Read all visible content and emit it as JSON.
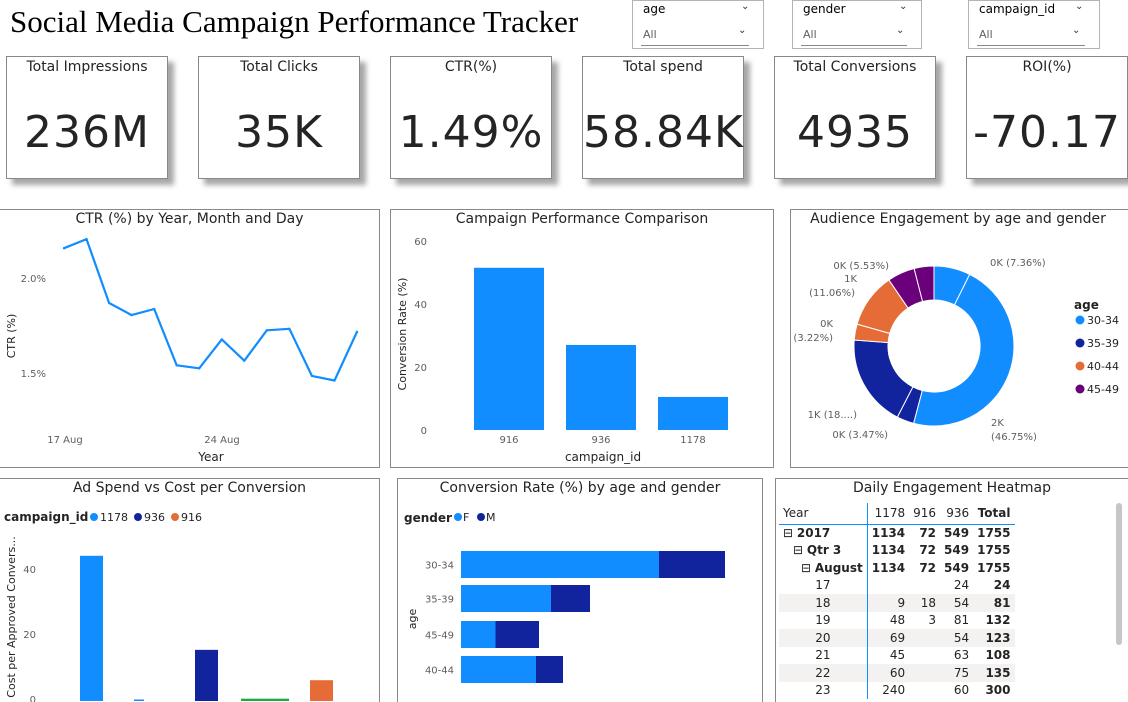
{
  "title": "Social Media Campaign Performance Tracker",
  "slicers": [
    {
      "label": "age",
      "value": "All"
    },
    {
      "label": "gender",
      "value": "All"
    },
    {
      "label": "campaign_id",
      "value": "All"
    }
  ],
  "kpis": [
    {
      "label": "Total Impressions",
      "value": "236M"
    },
    {
      "label": "Total Clicks",
      "value": "35K"
    },
    {
      "label": "CTR(%)",
      "value": "1.49%"
    },
    {
      "label": "Total spend",
      "value": "58.84K"
    },
    {
      "label": "Total Conversions",
      "value": "4935"
    },
    {
      "label": "ROI(%)",
      "value": "-70.17"
    }
  ],
  "colors": {
    "blue": "#118dff",
    "navy": "#12239e",
    "orange": "#e66c37",
    "purple": "#6b007b",
    "teal": "#1aab40"
  },
  "ctr_chart": {
    "title": "CTR (%) by Year, Month and Day",
    "xlabel": "Year",
    "ylabel": "CTR (%)",
    "y_ticks": [
      "2.0%",
      "1.5%"
    ],
    "x_ticks": [
      "17 Aug",
      "24 Aug"
    ]
  },
  "campaign_chart": {
    "title": "Campaign Performance Comparison",
    "xlabel": "campaign_id",
    "ylabel": "Conversion Rate (%)",
    "y_ticks": [
      "60",
      "40",
      "20",
      "0"
    ]
  },
  "donut_chart": {
    "title": "Audience Engagement by age and gender",
    "legend_title": "age",
    "labels": {
      "l3034a": "2K",
      "l3034b": "(46.75%)",
      "l3539": "0K (3.47%)",
      "l3539b": "1K (18....)",
      "l4044a": "0K",
      "l4044b": "(3.22%)",
      "l4049a": "1K",
      "l4049b": "(11.06%)",
      "l4549": "0K (5.53%)",
      "ltop": "0K (7.36%)"
    }
  },
  "adspend_chart": {
    "title": "Ad Spend vs Cost per Conversion",
    "legend_title": "campaign_id",
    "ylabel": "Cost per Approved Convers...",
    "y_ticks": [
      "40",
      "20",
      "0"
    ]
  },
  "conv_chart": {
    "title": "Conversion Rate (%) by age and gender",
    "legend_title": "gender",
    "ylabel": "age"
  },
  "heatmap": {
    "title": "Daily Engagement Heatmap",
    "headers": [
      "Year",
      "1178",
      "916",
      "936",
      "Total"
    ],
    "rows": [
      {
        "label": "2017",
        "cells": [
          "1134",
          "72",
          "549",
          "1755"
        ],
        "kind": "year"
      },
      {
        "label": "Qtr 3",
        "cells": [
          "1134",
          "72",
          "549",
          "1755"
        ],
        "kind": "qtr"
      },
      {
        "label": "August",
        "cells": [
          "1134",
          "72",
          "549",
          "1755"
        ],
        "kind": "month"
      },
      {
        "label": "17",
        "cells": [
          "",
          "",
          "24",
          "24"
        ],
        "kind": "day"
      },
      {
        "label": "18",
        "cells": [
          "9",
          "18",
          "54",
          "81"
        ],
        "kind": "day"
      },
      {
        "label": "19",
        "cells": [
          "48",
          "3",
          "81",
          "132"
        ],
        "kind": "day"
      },
      {
        "label": "20",
        "cells": [
          "69",
          "",
          "54",
          "123"
        ],
        "kind": "day"
      },
      {
        "label": "21",
        "cells": [
          "45",
          "",
          "63",
          "108"
        ],
        "kind": "day"
      },
      {
        "label": "22",
        "cells": [
          "60",
          "",
          "75",
          "135"
        ],
        "kind": "day"
      },
      {
        "label": "23",
        "cells": [
          "240",
          "",
          "60",
          "300"
        ],
        "kind": "day"
      }
    ]
  },
  "chart_data": [
    {
      "type": "line",
      "title": "CTR (%) by Year, Month and Day",
      "xlabel": "Year",
      "ylabel": "CTR (%)",
      "x": [
        "2017-08-17",
        "2017-08-18",
        "2017-08-19",
        "2017-08-20",
        "2017-08-21",
        "2017-08-22",
        "2017-08-23",
        "2017-08-24",
        "2017-08-25",
        "2017-08-26",
        "2017-08-27",
        "2017-08-28",
        "2017-08-29",
        "2017-08-30"
      ],
      "values": [
        2.13,
        2.19,
        1.77,
        1.69,
        1.73,
        1.36,
        1.34,
        1.53,
        1.39,
        1.59,
        1.6,
        1.29,
        1.26,
        1.58
      ],
      "ylim": [
        1.0,
        2.25
      ]
    },
    {
      "type": "bar",
      "title": "Campaign Performance Comparison",
      "xlabel": "campaign_id",
      "ylabel": "Conversion Rate (%)",
      "categories": [
        "916",
        "936",
        "1178"
      ],
      "values": [
        51.5,
        27,
        10.5
      ],
      "ylim": [
        0,
        60
      ]
    },
    {
      "type": "pie",
      "title": "Audience Engagement by age and gender",
      "legend": [
        "30-34",
        "35-39",
        "40-44",
        "45-49"
      ],
      "slices": [
        {
          "age": "30-34",
          "value": 7.36
        },
        {
          "age": "30-34",
          "value": 46.75
        },
        {
          "age": "35-39",
          "value": 3.47
        },
        {
          "age": "35-39",
          "value": 18.61
        },
        {
          "age": "40-44",
          "value": 3.22
        },
        {
          "age": "40-44",
          "value": 11.06
        },
        {
          "age": "45-49",
          "value": 5.53
        },
        {
          "age": "45-49",
          "value": 4.0
        }
      ]
    },
    {
      "type": "bar",
      "title": "Ad Spend vs Cost per Conversion",
      "ylabel": "Cost per Approved Convers...",
      "legend": [
        "1178",
        "936",
        "916"
      ],
      "bars": [
        {
          "series": "1178",
          "value": 44
        },
        {
          "series": "1178",
          "value": 0.4
        },
        {
          "series": "936",
          "value": 15.5
        },
        {
          "series": "other",
          "value": 0.7
        },
        {
          "series": "916",
          "value": 6.3
        }
      ],
      "ylim": [
        0,
        48
      ]
    },
    {
      "type": "bar",
      "title": "Conversion Rate (%) by age and gender",
      "ylabel": "age",
      "legend": [
        "F",
        "M"
      ],
      "categories": [
        "30-34",
        "35-39",
        "45-49",
        "40-44"
      ],
      "series": [
        {
          "name": "F",
          "values": [
            66,
            30,
            11.5,
            25
          ]
        },
        {
          "name": "M",
          "values": [
            22,
            13,
            14.5,
            9
          ]
        }
      ]
    }
  ]
}
